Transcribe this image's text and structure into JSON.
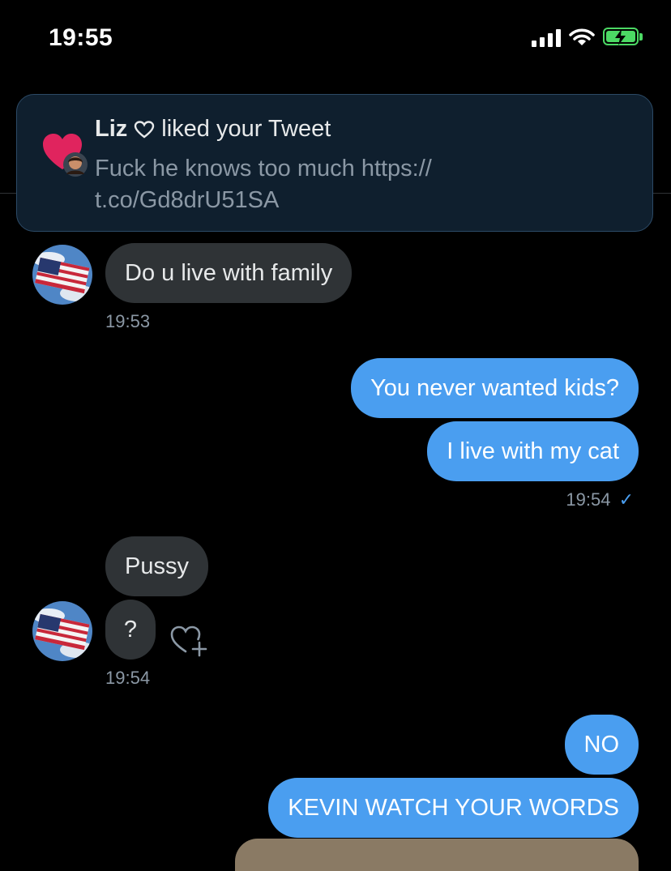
{
  "status_bar": {
    "time": "19:55",
    "signal_bars": 4,
    "battery_charging": true
  },
  "notification": {
    "user": "Liz",
    "action": "liked your Tweet",
    "line1": "Fuck he knows too much https://",
    "line2": "t.co/Gd8drU51SA",
    "icon": "heart-icon"
  },
  "messages": {
    "m1": "Do u live with family",
    "t1": "19:53",
    "m2": "You never wanted kids?",
    "m3": "I live with my cat",
    "t2": "19:54",
    "read_mark": "✓",
    "m4": "Pussy",
    "m5": "?",
    "t3": "19:54",
    "m6": "NO",
    "m7": "KEVIN WATCH YOUR WORDS"
  },
  "colors": {
    "outgoing": "#4a9ef0",
    "incoming": "#2f3336",
    "accent": "#e0245e"
  }
}
